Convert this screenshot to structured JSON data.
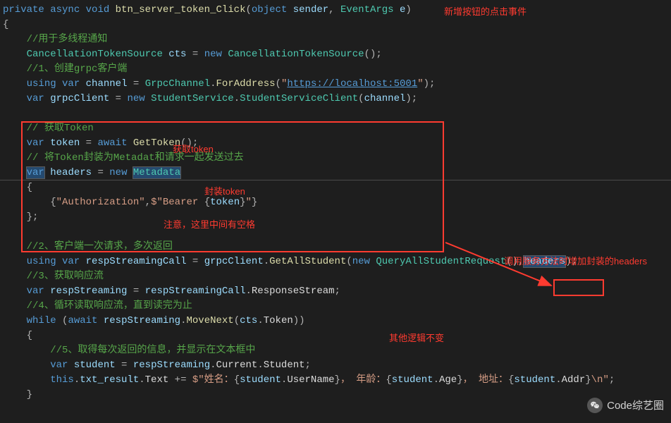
{
  "annotations": {
    "title_event": "新增按钮的点击事件",
    "get_token": "获取token",
    "pack_token": "封装token",
    "space_note": "注意，这里中间有空格",
    "add_headers": "调用服务方法时增加封装的headers",
    "other_unchanged": "其他逻辑不变"
  },
  "watermark": "Code综艺圈",
  "lines": [
    [
      {
        "t": "private",
        "c": "kw"
      },
      {
        "t": " "
      },
      {
        "t": "async",
        "c": "kw"
      },
      {
        "t": " "
      },
      {
        "t": "void",
        "c": "kw"
      },
      {
        "t": " "
      },
      {
        "t": "btn_server_token_Click",
        "c": "method"
      },
      {
        "t": "(",
        "c": "punct"
      },
      {
        "t": "object",
        "c": "kw"
      },
      {
        "t": " "
      },
      {
        "t": "sender",
        "c": "ident"
      },
      {
        "t": ", ",
        "c": "punct"
      },
      {
        "t": "EventArgs",
        "c": "type"
      },
      {
        "t": " "
      },
      {
        "t": "e",
        "c": "ident"
      },
      {
        "t": ")",
        "c": "punct"
      }
    ],
    [
      {
        "t": "{",
        "c": "punct"
      }
    ],
    [
      {
        "t": "    "
      },
      {
        "t": "//用于多线程通知",
        "c": "comment"
      }
    ],
    [
      {
        "t": "    "
      },
      {
        "t": "CancellationTokenSource",
        "c": "type"
      },
      {
        "t": " "
      },
      {
        "t": "cts",
        "c": "ident"
      },
      {
        "t": " = ",
        "c": "punct"
      },
      {
        "t": "new",
        "c": "kw"
      },
      {
        "t": " "
      },
      {
        "t": "CancellationTokenSource",
        "c": "type"
      },
      {
        "t": "();",
        "c": "punct"
      }
    ],
    [
      {
        "t": "    "
      },
      {
        "t": "//1、创建grpc客户端",
        "c": "comment"
      }
    ],
    [
      {
        "t": "    "
      },
      {
        "t": "using",
        "c": "kw"
      },
      {
        "t": " "
      },
      {
        "t": "var",
        "c": "kw"
      },
      {
        "t": " "
      },
      {
        "t": "channel",
        "c": "ident"
      },
      {
        "t": " = ",
        "c": "punct"
      },
      {
        "t": "GrpcChannel",
        "c": "type"
      },
      {
        "t": ".",
        "c": "punct"
      },
      {
        "t": "ForAddress",
        "c": "method"
      },
      {
        "t": "(",
        "c": "punct"
      },
      {
        "t": "\"",
        "c": "str"
      },
      {
        "t": "https://localhost:5001",
        "c": "url"
      },
      {
        "t": "\"",
        "c": "str"
      },
      {
        "t": ");",
        "c": "punct"
      }
    ],
    [
      {
        "t": "    "
      },
      {
        "t": "var",
        "c": "kw"
      },
      {
        "t": " "
      },
      {
        "t": "grpcClient",
        "c": "ident"
      },
      {
        "t": " = ",
        "c": "punct"
      },
      {
        "t": "new",
        "c": "kw"
      },
      {
        "t": " "
      },
      {
        "t": "StudentService",
        "c": "type"
      },
      {
        "t": ".",
        "c": "punct"
      },
      {
        "t": "StudentServiceClient",
        "c": "type"
      },
      {
        "t": "(",
        "c": "punct"
      },
      {
        "t": "channel",
        "c": "ident"
      },
      {
        "t": ");",
        "c": "punct"
      }
    ],
    [
      {
        "t": " "
      }
    ],
    [
      {
        "t": "    "
      },
      {
        "t": "// 获取Token",
        "c": "comment"
      }
    ],
    [
      {
        "t": "    "
      },
      {
        "t": "var",
        "c": "kw"
      },
      {
        "t": " "
      },
      {
        "t": "token",
        "c": "ident"
      },
      {
        "t": " = ",
        "c": "punct"
      },
      {
        "t": "await",
        "c": "kw"
      },
      {
        "t": " "
      },
      {
        "t": "GetToken",
        "c": "method"
      },
      {
        "t": "();",
        "c": "punct"
      }
    ],
    [
      {
        "t": "    "
      },
      {
        "t": "// 将Token封装为Metadat和请求一起发送过去",
        "c": "comment"
      }
    ],
    [
      {
        "t": "    "
      },
      {
        "t": "var",
        "c": "kw selbox"
      },
      {
        "t": " "
      },
      {
        "t": "headers",
        "c": "ident"
      },
      {
        "t": " = ",
        "c": "punct"
      },
      {
        "t": "new",
        "c": "kw"
      },
      {
        "t": " "
      },
      {
        "t": "Metadata",
        "c": "type selbox"
      }
    ],
    [
      {
        "t": "    {",
        "c": "punct"
      }
    ],
    [
      {
        "t": "        "
      },
      {
        "t": "{",
        "c": "punct"
      },
      {
        "t": "\"Authorization\"",
        "c": "str"
      },
      {
        "t": ",",
        "c": "punct"
      },
      {
        "t": "$\"Bearer ",
        "c": "str"
      },
      {
        "t": "{",
        "c": "punct"
      },
      {
        "t": "token",
        "c": "ident"
      },
      {
        "t": "}",
        "c": "punct"
      },
      {
        "t": "\"",
        "c": "str"
      },
      {
        "t": "}",
        "c": "punct"
      }
    ],
    [
      {
        "t": "    };",
        "c": "punct"
      }
    ],
    [
      {
        "t": " "
      }
    ],
    [
      {
        "t": "    "
      },
      {
        "t": "//2、客户端一次请求，多次返回",
        "c": "comment"
      }
    ],
    [
      {
        "t": "    "
      },
      {
        "t": "using",
        "c": "kw"
      },
      {
        "t": " "
      },
      {
        "t": "var",
        "c": "kw"
      },
      {
        "t": " "
      },
      {
        "t": "respStreamingCall",
        "c": "ident"
      },
      {
        "t": " = ",
        "c": "punct"
      },
      {
        "t": "grpcClient",
        "c": "ident"
      },
      {
        "t": ".",
        "c": "punct"
      },
      {
        "t": "GetAllStudent",
        "c": "method"
      },
      {
        "t": "(",
        "c": "punct"
      },
      {
        "t": "new",
        "c": "kw"
      },
      {
        "t": " "
      },
      {
        "t": "QueryAllStudentRequest",
        "c": "type"
      },
      {
        "t": "(),",
        "c": "punct"
      },
      {
        "t": "headers",
        "c": "ident selbox"
      },
      {
        "t": ");",
        "c": "punct"
      }
    ],
    [
      {
        "t": "    "
      },
      {
        "t": "//3、获取响应流",
        "c": "comment"
      }
    ],
    [
      {
        "t": "    "
      },
      {
        "t": "var",
        "c": "kw"
      },
      {
        "t": " "
      },
      {
        "t": "respStreaming",
        "c": "ident"
      },
      {
        "t": " = ",
        "c": "punct"
      },
      {
        "t": "respStreamingCall",
        "c": "ident"
      },
      {
        "t": ".",
        "c": "punct"
      },
      {
        "t": "ResponseStream",
        "c": "white"
      },
      {
        "t": ";",
        "c": "punct"
      }
    ],
    [
      {
        "t": "    "
      },
      {
        "t": "//4、循环读取响应流，直到读完为止",
        "c": "comment"
      }
    ],
    [
      {
        "t": "    "
      },
      {
        "t": "while",
        "c": "kw"
      },
      {
        "t": " (",
        "c": "punct"
      },
      {
        "t": "await",
        "c": "kw"
      },
      {
        "t": " "
      },
      {
        "t": "respStreaming",
        "c": "ident"
      },
      {
        "t": ".",
        "c": "punct"
      },
      {
        "t": "MoveNext",
        "c": "method"
      },
      {
        "t": "(",
        "c": "punct"
      },
      {
        "t": "cts",
        "c": "ident"
      },
      {
        "t": ".",
        "c": "punct"
      },
      {
        "t": "Token",
        "c": "white"
      },
      {
        "t": "))",
        "c": "punct"
      }
    ],
    [
      {
        "t": "    {",
        "c": "punct"
      }
    ],
    [
      {
        "t": "        "
      },
      {
        "t": "//5、取得每次返回的信息，并显示在文本框中",
        "c": "comment"
      }
    ],
    [
      {
        "t": "        "
      },
      {
        "t": "var",
        "c": "kw"
      },
      {
        "t": " "
      },
      {
        "t": "student",
        "c": "ident"
      },
      {
        "t": " = ",
        "c": "punct"
      },
      {
        "t": "respStreaming",
        "c": "ident"
      },
      {
        "t": ".",
        "c": "punct"
      },
      {
        "t": "Current",
        "c": "white"
      },
      {
        "t": ".",
        "c": "punct"
      },
      {
        "t": "Student",
        "c": "white"
      },
      {
        "t": ";",
        "c": "punct"
      }
    ],
    [
      {
        "t": "        "
      },
      {
        "t": "this",
        "c": "kw"
      },
      {
        "t": ".",
        "c": "punct"
      },
      {
        "t": "txt_result",
        "c": "ident"
      },
      {
        "t": ".",
        "c": "punct"
      },
      {
        "t": "Text",
        "c": "white"
      },
      {
        "t": " += ",
        "c": "punct"
      },
      {
        "t": "$\"姓名：",
        "c": "str"
      },
      {
        "t": "{",
        "c": "punct"
      },
      {
        "t": "student",
        "c": "ident"
      },
      {
        "t": ".",
        "c": "punct"
      },
      {
        "t": "UserName",
        "c": "white"
      },
      {
        "t": "}",
        "c": "punct"
      },
      {
        "t": "， 年龄：",
        "c": "str"
      },
      {
        "t": "{",
        "c": "punct"
      },
      {
        "t": "student",
        "c": "ident"
      },
      {
        "t": ".",
        "c": "punct"
      },
      {
        "t": "Age",
        "c": "white"
      },
      {
        "t": "}",
        "c": "punct"
      },
      {
        "t": "， 地址：",
        "c": "str"
      },
      {
        "t": "{",
        "c": "punct"
      },
      {
        "t": "student",
        "c": "ident"
      },
      {
        "t": ".",
        "c": "punct"
      },
      {
        "t": "Addr",
        "c": "white"
      },
      {
        "t": "}",
        "c": "punct"
      },
      {
        "t": "\\n\"",
        "c": "str"
      },
      {
        "t": ";",
        "c": "punct"
      }
    ],
    [
      {
        "t": "    }",
        "c": "punct"
      }
    ]
  ]
}
